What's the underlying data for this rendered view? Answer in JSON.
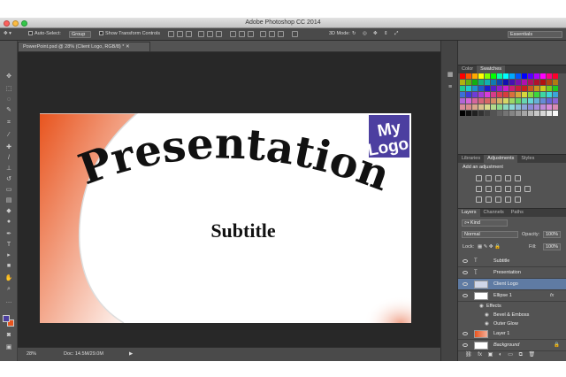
{
  "window": {
    "title": "Adobe Photoshop CC 2014"
  },
  "options": {
    "auto_select": "Auto-Select:",
    "group_value": "Group",
    "show_transform": "Show Transform Controls",
    "mode_3d": "3D Mode:",
    "workspace": "Essentials"
  },
  "document": {
    "tab_title": "PowerPoint.psd @ 28% (Client Logo, RGB/8) *"
  },
  "slide": {
    "title": "Presentation",
    "subtitle": "Subtitle",
    "logo_line1": "My",
    "logo_line2": "Logo",
    "accent_color": "#e8541e",
    "logo_color": "#4c3fa0"
  },
  "status": {
    "zoom": "28%",
    "doc": "Doc: 14.5M/29.0M"
  },
  "panels": {
    "color_tabs": [
      "Color",
      "Swatches"
    ],
    "adjust_tabs": [
      "Libraries",
      "Adjustments",
      "Styles"
    ],
    "add_adjustment": "Add an adjustment",
    "layer_tabs": [
      "Layers",
      "Channels",
      "Paths"
    ],
    "kind": "Kind",
    "blend_mode": "Normal",
    "opacity_label": "Opacity:",
    "opacity_value": "100%",
    "lock_label": "Lock:",
    "fill_label": "Fill:",
    "fill_value": "100%"
  },
  "layers": [
    {
      "name": "Subtitle",
      "type": "text"
    },
    {
      "name": "Presentation",
      "type": "warp-text"
    },
    {
      "name": "Client Logo",
      "type": "smart",
      "selected": true
    },
    {
      "name": "Ellipse 1",
      "type": "shape",
      "fx": "fx"
    },
    {
      "name": "Effects",
      "type": "effects"
    },
    {
      "name": "Bevel & Emboss",
      "type": "effect"
    },
    {
      "name": "Outer Glow",
      "type": "effect"
    },
    {
      "name": "Layer 1",
      "type": "pixel"
    },
    {
      "name": "Background",
      "type": "background"
    }
  ]
}
